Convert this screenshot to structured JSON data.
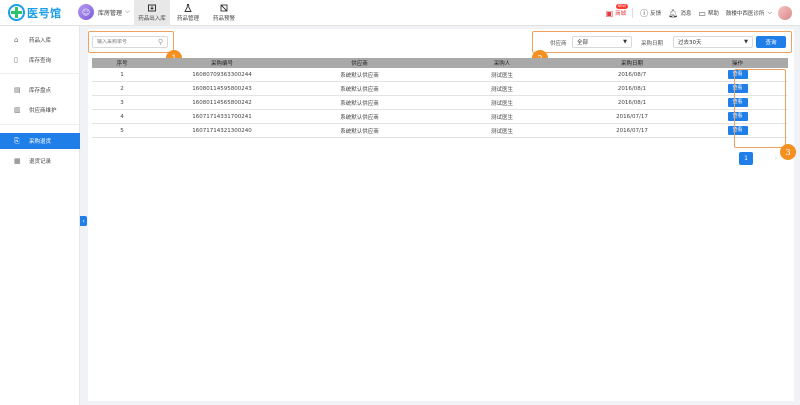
{
  "app": {
    "logo_text": "医号馆",
    "module_label": "库房管理",
    "module_avatar": "☺"
  },
  "nav_tabs": [
    {
      "label": "药品出入库",
      "icon": "inbox-icon"
    },
    {
      "label": "药品管理",
      "icon": "flask-icon"
    },
    {
      "label": "药品预警",
      "icon": "alert-icon"
    }
  ],
  "top_right": {
    "mall_label": "商城",
    "mall_badge": "NEW",
    "feedback_label": "反馈",
    "message_label": "消息",
    "help_label": "帮助",
    "clinic_name": "鼓楼中西医诊所"
  },
  "sidebar": {
    "items": [
      {
        "label": "药品入库"
      },
      {
        "label": "库存查询"
      },
      {
        "label": "库存盘点"
      },
      {
        "label": "供应商维护"
      },
      {
        "label": "采购退货"
      },
      {
        "label": "退货记录"
      }
    ],
    "active_index": 4,
    "collapse_icon": "‹"
  },
  "filters": {
    "search_placeholder": "输入采购单号",
    "supplier_label": "供应商",
    "supplier_value": "全部",
    "date_label": "采购日期",
    "date_value": "过去30天",
    "query_label": "查询"
  },
  "annotations": [
    "1",
    "2",
    "3"
  ],
  "table": {
    "headers": [
      "序号",
      "采购编号",
      "供应商",
      "采购人",
      "采购日期",
      "操作"
    ],
    "rows": [
      {
        "no": "1",
        "code": "16080709363300244",
        "supplier": "系统默认供应商",
        "buyer": "测试医生",
        "date": "2016/08/7",
        "action": "查看"
      },
      {
        "no": "2",
        "code": "16080114595800243",
        "supplier": "系统默认供应商",
        "buyer": "测试医生",
        "date": "2016/08/1",
        "action": "查看"
      },
      {
        "no": "3",
        "code": "16080114565800242",
        "supplier": "系统默认供应商",
        "buyer": "测试医生",
        "date": "2016/08/1",
        "action": "查看"
      },
      {
        "no": "4",
        "code": "16071714331700241",
        "supplier": "系统默认供应商",
        "buyer": "测试医生",
        "date": "2016/07/17",
        "action": "查看"
      },
      {
        "no": "5",
        "code": "16071714321300240",
        "supplier": "系统默认供应商",
        "buyer": "测试医生",
        "date": "2016/07/17",
        "action": "查看"
      }
    ]
  },
  "pagination": {
    "current_page": "1",
    "next_label": "›"
  },
  "colors": {
    "accent": "#1f7ee8",
    "annotation": "#f39021",
    "header_gray": "#a9a9a9"
  }
}
